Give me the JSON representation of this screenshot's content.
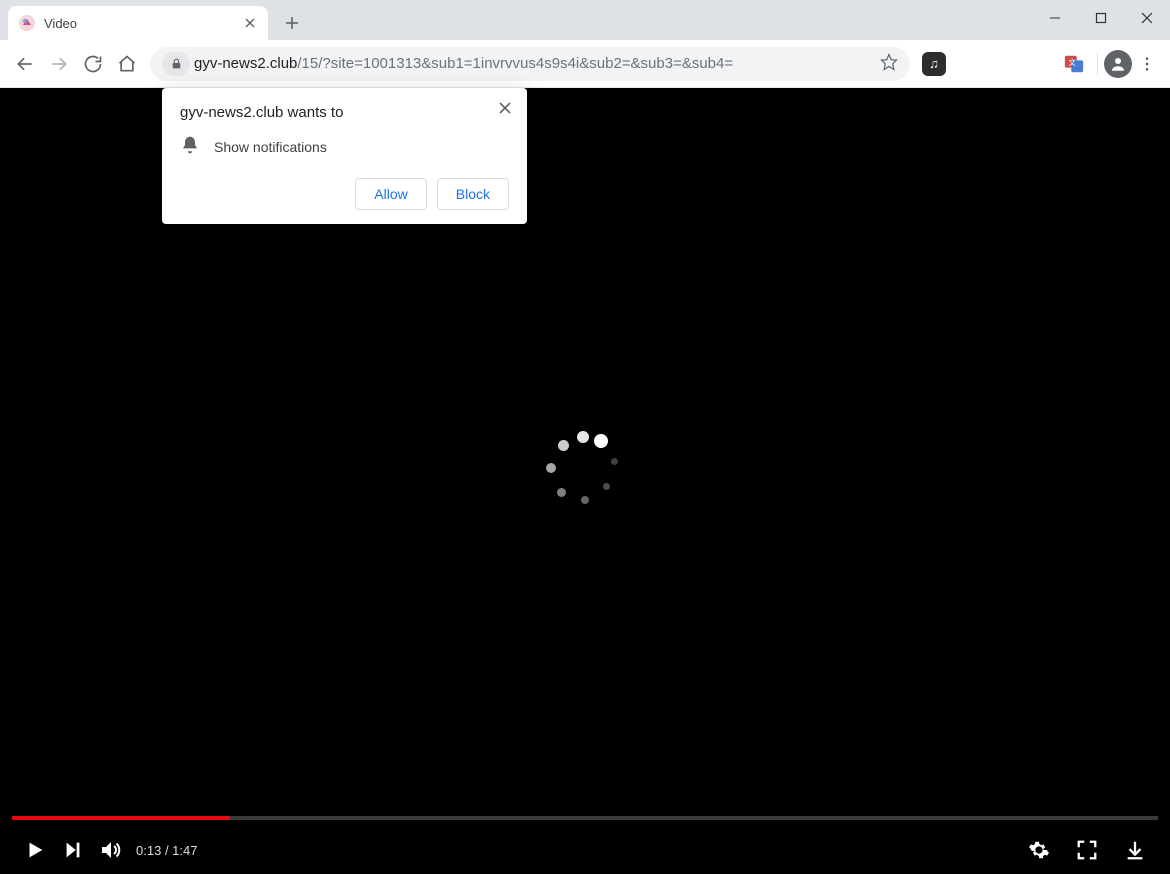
{
  "tab": {
    "title": "Video"
  },
  "address": {
    "domain": "gyv-news2.club",
    "path": "/15/?site=1001313&sub1=1invrvvus4s9s4i&sub2=&sub3=&sub4="
  },
  "permission": {
    "title": "gyv-news2.club wants to",
    "request": "Show notifications",
    "allow": "Allow",
    "block": "Block"
  },
  "video": {
    "time_current": "0:13",
    "time_total": "1:47",
    "progress_percent": 19
  }
}
